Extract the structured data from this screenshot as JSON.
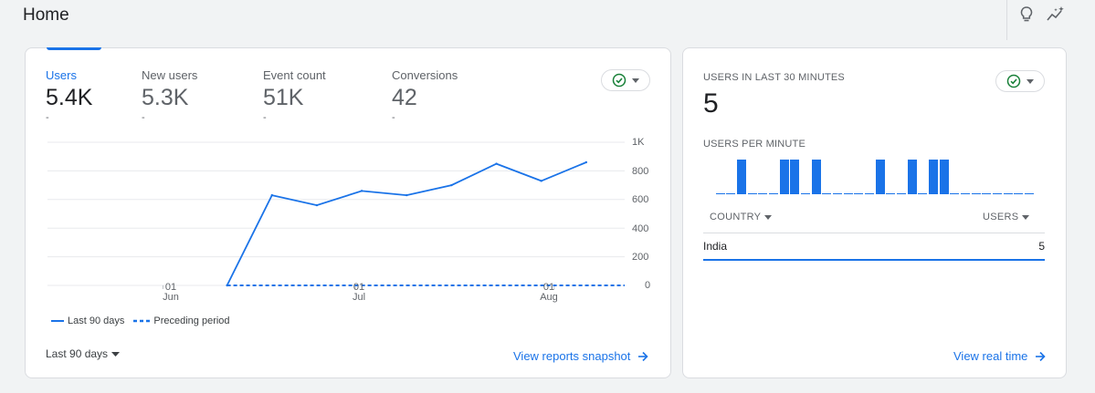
{
  "page": {
    "title": "Home"
  },
  "header": {
    "icons": [
      "lightbulb-icon",
      "insights-sparkle-icon"
    ]
  },
  "overview": {
    "metrics": [
      {
        "label": "Users",
        "value": "5.4K",
        "sub": "-"
      },
      {
        "label": "New users",
        "value": "5.3K",
        "sub": "-"
      },
      {
        "label": "Event count",
        "value": "51K",
        "sub": "-"
      },
      {
        "label": "Conversions",
        "value": "42",
        "sub": "-"
      }
    ],
    "status_icon": "check-circle-icon",
    "accent_color": "#1a73e8",
    "status_color": "#188038",
    "chart_data": {
      "type": "line",
      "x": [
        "2022-05-14",
        "2022-05-21",
        "2022-05-28",
        "2022-06-04",
        "2022-06-11",
        "2022-06-18",
        "2022-06-25",
        "2022-07-02",
        "2022-07-09",
        "2022-07-16",
        "2022-07-23",
        "2022-07-30",
        "2022-08-06",
        "2022-08-12"
      ],
      "series": [
        {
          "name": "Last 90 days",
          "values": [
            null,
            null,
            null,
            null,
            0,
            630,
            560,
            660,
            630,
            700,
            850,
            730,
            860,
            null
          ],
          "style": "solid"
        },
        {
          "name": "Preceding period",
          "values": [
            null,
            null,
            null,
            null,
            0,
            0,
            0,
            0,
            0,
            0,
            0,
            0,
            0,
            0
          ],
          "style": "dashed"
        }
      ],
      "xticks": [
        {
          "day": "01",
          "month": "Jun"
        },
        {
          "day": "01",
          "month": "Jul"
        },
        {
          "day": "01",
          "month": "Aug"
        }
      ],
      "yticks": [
        "1K",
        "800",
        "600",
        "400",
        "200",
        "0"
      ],
      "ylim": [
        0,
        1000
      ],
      "grid": true,
      "legend_position": "bottom-left"
    },
    "date_range_label": "Last 90 days",
    "snapshot_link": "View reports snapshot"
  },
  "realtime": {
    "title": "USERS IN LAST 30 MINUTES",
    "value": "5",
    "per_minute_label": "USERS PER MINUTE",
    "per_minute_chart": {
      "type": "bar",
      "values": [
        0,
        0,
        1,
        0,
        0,
        0,
        1,
        1,
        0,
        1,
        0,
        0,
        0,
        0,
        0,
        1,
        0,
        0,
        1,
        0,
        1,
        1,
        0,
        0,
        0,
        0,
        0,
        0,
        0,
        0
      ],
      "max": 1
    },
    "table": {
      "columns": [
        "COUNTRY",
        "USERS"
      ],
      "rows": [
        {
          "country": "India",
          "users": "5"
        }
      ]
    },
    "link": "View real time"
  }
}
